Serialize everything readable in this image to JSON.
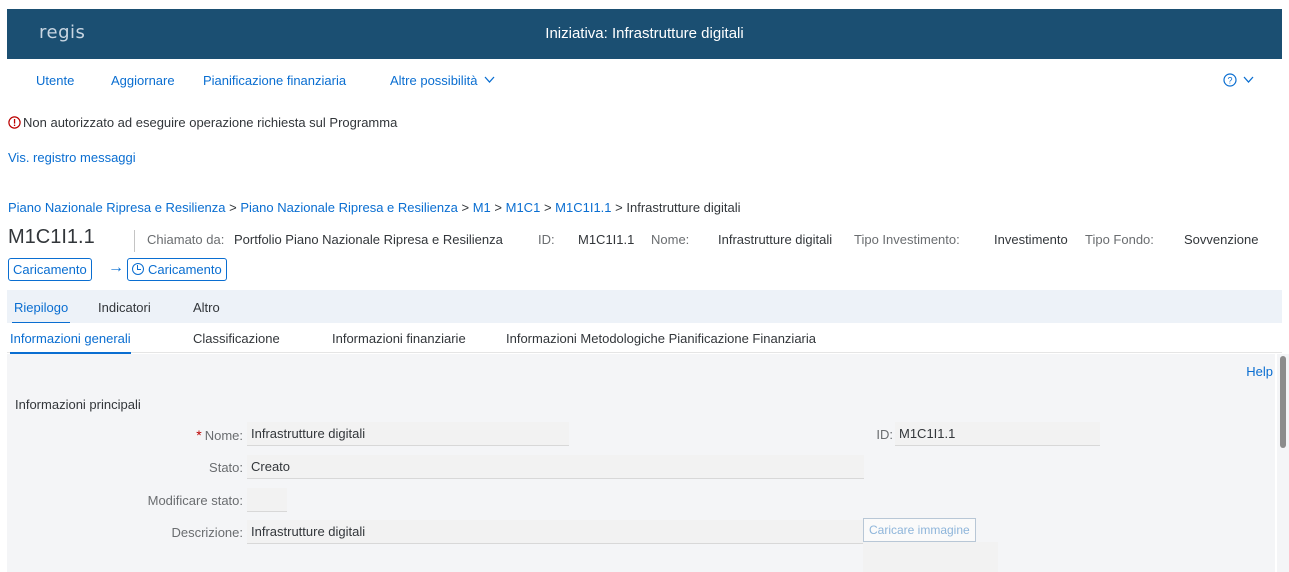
{
  "shell": {
    "logo": "regis",
    "title": "Iniziativa: Infrastrutture digitali"
  },
  "menu": {
    "items": [
      "Utente",
      "Aggiornare",
      "Pianificazione finanziaria",
      "Altre possibilità"
    ],
    "more_chevron": "chevron-down-icon",
    "help_icon": "help-circle-icon"
  },
  "messages": {
    "error": "Non autorizzato ad eseguire operazione richiesta sul Programma",
    "log_link": "Vis. registro messaggi"
  },
  "breadcrumb": {
    "links": [
      "Piano Nazionale Ripresa e Resilienza",
      "Piano Nazionale Ripresa e Resilienza",
      "M1",
      "M1C1",
      "M1C1I1.1"
    ],
    "separator": ">",
    "current": "Infrastrutture digitali"
  },
  "header": {
    "object_id": "M1C1I1.1",
    "called_by_label": "Chiamato da:",
    "called_by_value": "Portfolio Piano Nazionale Ripresa e Resilienza",
    "id_label": "ID:",
    "id_value": "M1C1I1.1",
    "name_label": "Nome:",
    "name_value": "Infrastrutture digitali",
    "inv_type_label": "Tipo Investimento:",
    "inv_type_value": "Investimento",
    "fund_type_label": "Tipo Fondo:",
    "fund_type_value": "Sovvenzione"
  },
  "actions": {
    "upload_label": "Caricamento",
    "upload_scheduled_label": "Caricamento"
  },
  "tabs_primary": [
    "Riepilogo",
    "Indicatori",
    "Altro"
  ],
  "tabs_secondary": [
    "Informazioni generali",
    "Classificazione",
    "Informazioni finanziarie",
    "Informazioni Metodologiche Pianificazione Finanziaria"
  ],
  "content": {
    "help_link": "Help",
    "section_title": "Informazioni principali",
    "required_marker": "*",
    "name_label": "Nome:",
    "name_value": "Infrastrutture digitali",
    "id_label": "ID:",
    "id_value": "M1C1I1.1",
    "status_label": "Stato:",
    "status_value": "Creato",
    "change_status_label": "Modificare stato:",
    "change_status_value": "",
    "description_label": "Descrizione:",
    "description_value": "Infrastrutture digitali",
    "upload_image_button": "Caricare immagine"
  },
  "colors": {
    "shell_bg": "#1b4f72",
    "link": "#0a6ed1",
    "error": "#bb0000",
    "tabbar_bg": "#edf2f8"
  }
}
